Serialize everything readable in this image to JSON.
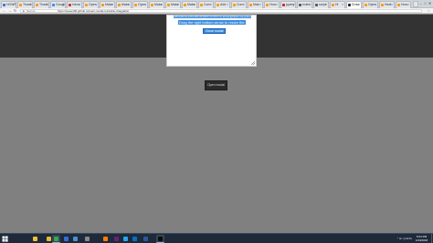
{
  "browser": {
    "tabs": [
      {
        "label": "HOWT",
        "active": false,
        "favicon_color": "#3b6fc2"
      },
      {
        "label": "Thank",
        "active": false,
        "favicon_color": "#ff9800"
      },
      {
        "label": "Thank",
        "active": false,
        "favicon_color": "#ff9800"
      },
      {
        "label": "Google",
        "active": false,
        "favicon_color": "#4285f4"
      },
      {
        "label": "Inbox",
        "active": false,
        "favicon_color": "#d93025"
      },
      {
        "label": "Open",
        "active": false,
        "favicon_color": "#ff9800"
      },
      {
        "label": "Make",
        "active": false,
        "favicon_color": "#ff9800"
      },
      {
        "label": "Make",
        "active": false,
        "favicon_color": "#ff9800"
      },
      {
        "label": "Open",
        "active": false,
        "favicon_color": "#ff9800"
      },
      {
        "label": "Make",
        "active": false,
        "favicon_color": "#ff9800"
      },
      {
        "label": "Make",
        "active": false,
        "favicon_color": "#ff9800"
      },
      {
        "label": "Make",
        "active": false,
        "favicon_color": "#ff9800"
      },
      {
        "label": "Com",
        "active": false,
        "favicon_color": "#ff9800"
      },
      {
        "label": "Add",
        "active": false,
        "favicon_color": "#ff9800"
      },
      {
        "label": "Com",
        "active": false,
        "favicon_color": "#ff9800"
      },
      {
        "label": "Mak",
        "active": false,
        "favicon_color": "#ff9800"
      },
      {
        "label": "How",
        "active": false,
        "favicon_color": "#ff9800"
      },
      {
        "label": "jquery",
        "active": false,
        "favicon_color": "#c62828"
      },
      {
        "label": "exten",
        "active": false,
        "favicon_color": "#555555"
      },
      {
        "label": "script",
        "active": false,
        "favicon_color": "#555555"
      },
      {
        "label": "Hi",
        "active": false,
        "favicon_color": "#ff9800"
      },
      {
        "label": "Draw",
        "active": true,
        "favicon_color": "#222222"
      },
      {
        "label": "Open",
        "active": false,
        "favicon_color": "#ff9800"
      },
      {
        "label": "Heal",
        "active": false,
        "favicon_color": "#ff9800"
      },
      {
        "label": "How",
        "active": false,
        "favicon_color": "#ff9800"
      }
    ],
    "window_controls": [
      "minimize",
      "maximize",
      "close"
    ],
    "window_control_glyphs": [
      "–",
      "□",
      "✕"
    ],
    "nav": {
      "back": "←",
      "forward": "→",
      "reload": "↻"
    },
    "address": {
      "secure_label": "Secure",
      "url": "https://sesant96.github.io/react-modal-resizable-draggable/",
      "lock_glyph": "🔒",
      "star_glyph": "☆"
    }
  },
  "page": {
    "modal": {
      "text_line1": "ABCDEFGHIJKLMNOPQRSTUVWXYZ abcdefghijklmnopqrstuvwxyz",
      "text_line2": "Drag the right bottom arrow to resize the",
      "close_label": "Close modal",
      "selection_color": "#3b8ce0"
    },
    "open_modal_label": "Open modal",
    "header_color": "#333333",
    "background_color": "#808080"
  },
  "taskbar": {
    "items": [
      {
        "icon": "file-explorer-icon",
        "color": "#f2c037",
        "active": false
      },
      {
        "icon": "folder-icon",
        "color": "#e8b83a",
        "active": false
      },
      {
        "icon": "chrome-icon",
        "color": "#34a853",
        "active": true
      },
      {
        "icon": "media-player-icon",
        "color": "#2f6fd6",
        "active": false
      },
      {
        "icon": "photos-icon",
        "color": "#4a90d9",
        "active": false
      },
      {
        "icon": "settings-icon",
        "color": "#8a8a8a",
        "active": false
      },
      {
        "icon": "vlc-icon",
        "color": "#ff7f00",
        "active": false
      },
      {
        "icon": "visual-studio-icon",
        "color": "#68217a",
        "active": false
      },
      {
        "icon": "vscode-icon",
        "color": "#23a9f2",
        "active": false
      },
      {
        "icon": "outlook-icon",
        "color": "#0072c6",
        "active": false
      },
      {
        "icon": "word-icon",
        "color": "#2b579a",
        "active": false
      },
      {
        "icon": "terminal-icon",
        "color": "#0c0c0c",
        "active": true
      }
    ],
    "tray_text": "^  ⊞  ◁)  ENG",
    "clock_time": "5:04 PM",
    "clock_date": "1/23/2018"
  }
}
